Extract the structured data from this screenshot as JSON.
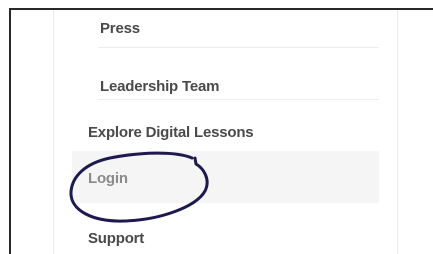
{
  "menu": {
    "items": [
      {
        "label": "Press"
      },
      {
        "label": "Leadership Team"
      },
      {
        "label": "Explore Digital Lessons"
      },
      {
        "label": "Login"
      },
      {
        "label": "Support"
      }
    ]
  },
  "colors": {
    "text": "#4a4a4a",
    "active_text": "#8a8a8a",
    "active_background": "#f5f5f5",
    "annotation_ink": "#1c1a4e"
  }
}
